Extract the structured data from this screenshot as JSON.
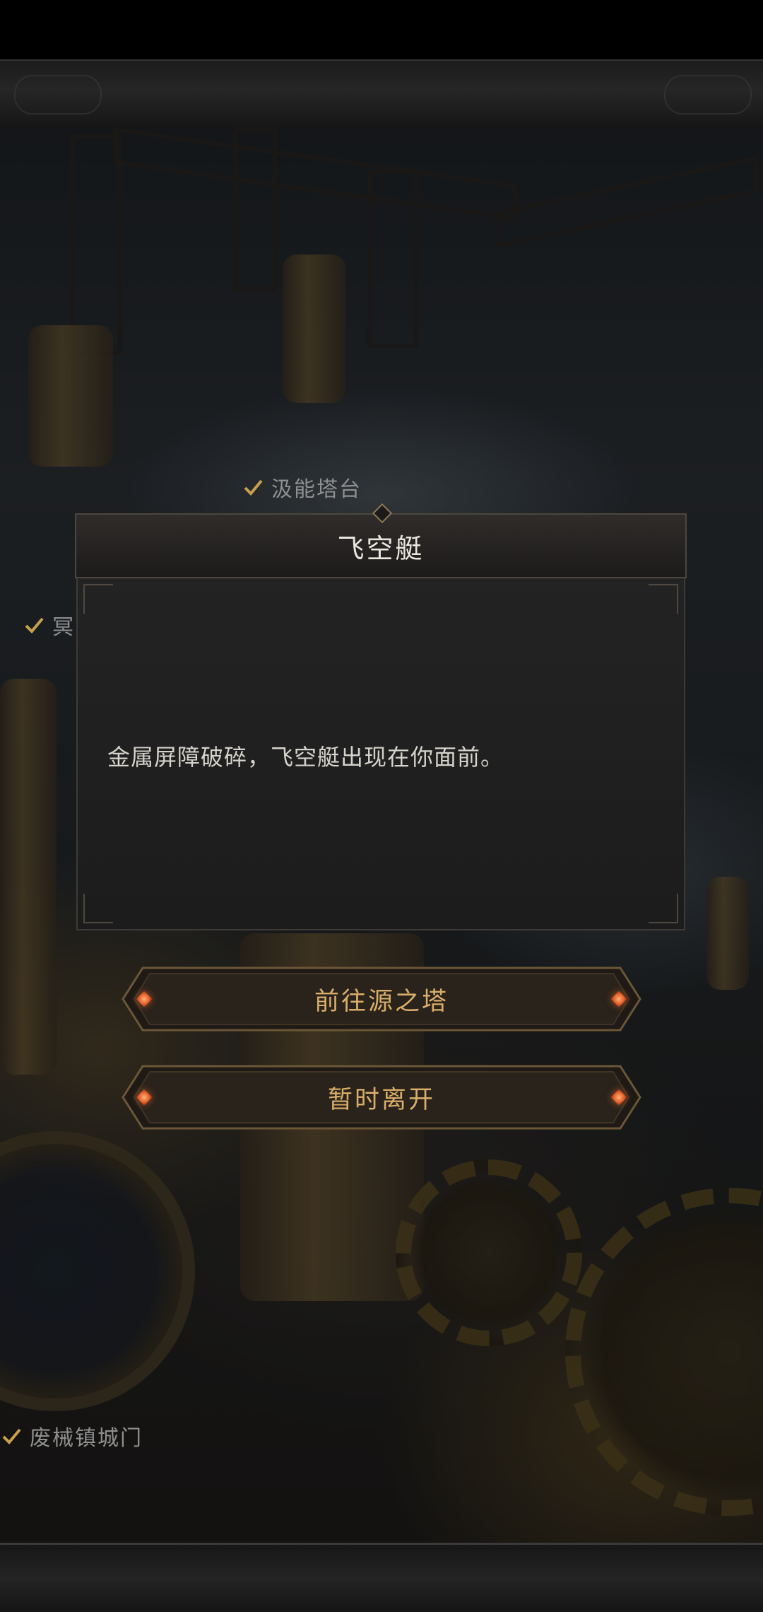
{
  "map": {
    "labels": [
      {
        "text": "汲能塔台",
        "visited": true
      },
      {
        "text": "冥",
        "visited": true
      },
      {
        "text": "废械镇城门",
        "visited": true
      }
    ]
  },
  "dialog": {
    "title": "飞空艇",
    "body": "金属屏障破碎，飞空艇出现在你面前。"
  },
  "choices": [
    {
      "label": "前往源之塔"
    },
    {
      "label": "暂时离开"
    }
  ],
  "colors": {
    "button_text": "#d9ae6a",
    "gem": "#e8642d",
    "checkmark": "#c9a04e"
  }
}
